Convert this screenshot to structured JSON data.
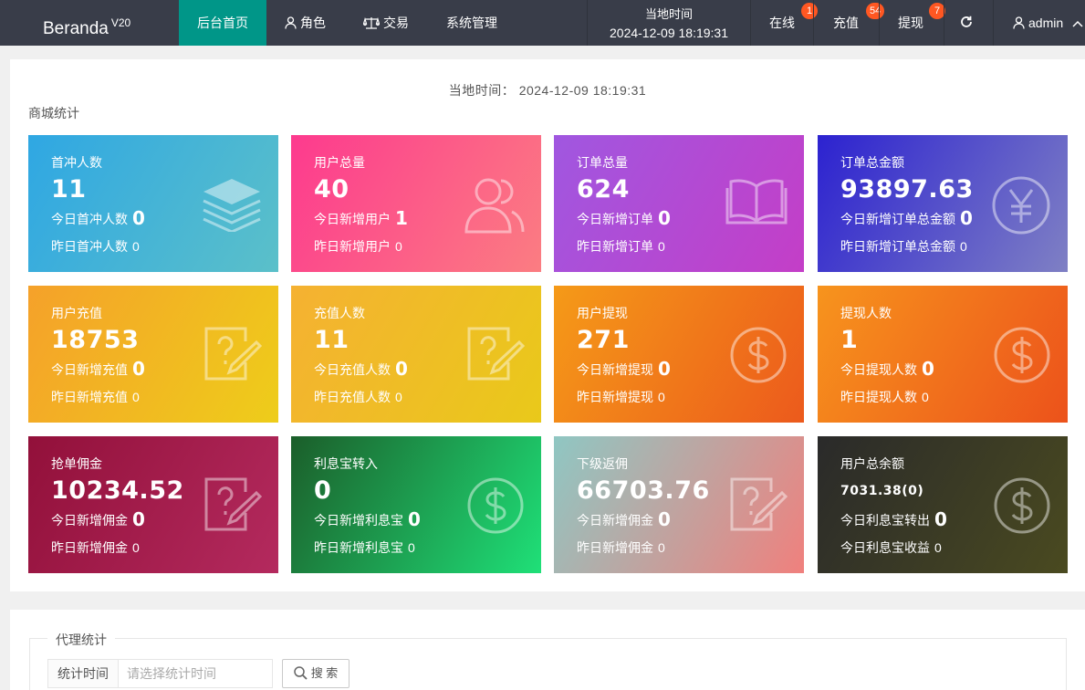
{
  "header": {
    "brand": "Beranda",
    "version": "V20",
    "nav": [
      {
        "label": "后台首页",
        "active": true
      },
      {
        "label": "角色"
      },
      {
        "label": "交易"
      },
      {
        "label": "系统管理"
      }
    ],
    "clock_label": "当地时间",
    "clock_value": "2024-12-09 18:19:31",
    "online_label": "在线",
    "online_count": "1",
    "recharge_label": "充值",
    "recharge_count": "54",
    "withdraw_label": "提现",
    "withdraw_count": "7",
    "refresh_icon": "refresh-icon",
    "user": "admin"
  },
  "main": {
    "local_time_label": "当地时间：",
    "local_time_value": "2024-12-09 18:19:31",
    "section_title": "商城统计",
    "cards": [
      {
        "title": "首冲人数",
        "value": "11",
        "today_label": "今日首冲人数",
        "today_value": "0",
        "yest_label": "昨日首冲人数",
        "yest_value": "0",
        "icon": "layers-icon",
        "color": "#2fa7e3"
      },
      {
        "title": "用户总量",
        "value": "40",
        "today_label": "今日新增用户",
        "today_value": "1",
        "yest_label": "昨日新增用户",
        "yest_value": "0",
        "icon": "users-icon",
        "color": "#fd3a8e"
      },
      {
        "title": "订单总量",
        "value": "624",
        "today_label": "今日新增订单",
        "today_value": "0",
        "yest_label": "昨日新增订单",
        "yest_value": "0",
        "icon": "book-icon",
        "color": "#a057e0"
      },
      {
        "title": "订单总金额",
        "value": "93897.63",
        "today_label": "今日新增订单总金额",
        "today_value": "0",
        "yest_label": "昨日新增订单总金额",
        "yest_value": "0",
        "icon": "yen-icon",
        "color": "#2c22d0"
      },
      {
        "title": "用户充值",
        "value": "18753",
        "today_label": "今日新增充值",
        "today_value": "0",
        "yest_label": "昨日新增充值",
        "yest_value": "0",
        "icon": "note-edit-icon",
        "color": "#f5a12a"
      },
      {
        "title": "充值人数",
        "value": "11",
        "today_label": "今日充值人数",
        "today_value": "0",
        "yest_label": "昨日充值人数",
        "yest_value": "0",
        "icon": "note-edit-icon",
        "color": "#f5b132"
      },
      {
        "title": "用户提现",
        "value": "271",
        "today_label": "今日新增提现",
        "today_value": "0",
        "yest_label": "昨日新增提现",
        "yest_value": "0",
        "icon": "dollar-icon",
        "color": "#f59a18"
      },
      {
        "title": "提现人数",
        "value": "1",
        "today_label": "今日提现人数",
        "today_value": "0",
        "yest_label": "昨日提现人数",
        "yest_value": "0",
        "icon": "dollar-icon",
        "color": "#f7941d"
      },
      {
        "title": "抢单佣金",
        "value": "10234.52",
        "today_label": "今日新增佣金",
        "today_value": "0",
        "yest_label": "昨日新增佣金",
        "yest_value": "0",
        "icon": "note-edit-icon",
        "color": "#92103a"
      },
      {
        "title": "利息宝转入",
        "value": "0",
        "today_label": "今日新增利息宝",
        "today_value": "0",
        "yest_label": "昨日新增利息宝",
        "yest_value": "0",
        "icon": "dollar-icon",
        "color": "#1b5e2a"
      },
      {
        "title": "下级返佣",
        "value": "66703.76",
        "today_label": "今日新增佣金",
        "today_value": "0",
        "yest_label": "昨日新增佣金",
        "yest_value": "0",
        "icon": "note-edit-icon",
        "color": "#8fc7c3"
      },
      {
        "title": "用户总余额",
        "value": "7031.38(0)",
        "today_label": "今日利息宝转出",
        "today_value": "0",
        "yest_label": "今日利息宝收益",
        "yest_value": "0",
        "icon": "dollar-icon",
        "color": "#2a2a2a"
      }
    ]
  },
  "agent": {
    "legend": "代理统计",
    "time_label": "统计时间",
    "time_placeholder": "请选择统计时间",
    "search_label": "搜 索"
  }
}
